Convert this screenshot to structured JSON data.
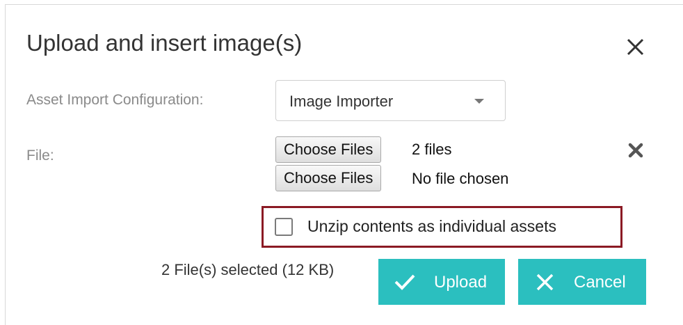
{
  "dialog": {
    "title": "Upload and insert image(s)",
    "close_icon": "close-icon"
  },
  "asset_import": {
    "label": "Asset Import Configuration:",
    "selected": "Image Importer",
    "caret_icon": "caret-down-icon"
  },
  "file": {
    "label": "File:",
    "inputs": [
      {
        "button_label": "Choose Files",
        "status": "2 files"
      },
      {
        "button_label": "Choose Files",
        "status": "No file chosen"
      }
    ],
    "remove_icon": "remove-icon"
  },
  "unzip": {
    "label": "Unzip contents as individual assets",
    "checked": false
  },
  "summary": {
    "selected_text": "2 File(s) selected (12 KB)"
  },
  "buttons": {
    "upload_label": "Upload",
    "upload_icon": "checkmark-icon",
    "cancel_label": "Cancel",
    "cancel_icon": "close-icon"
  },
  "colors": {
    "button_bg": "#2bbfbf",
    "highlight_border": "#8b1a24"
  }
}
